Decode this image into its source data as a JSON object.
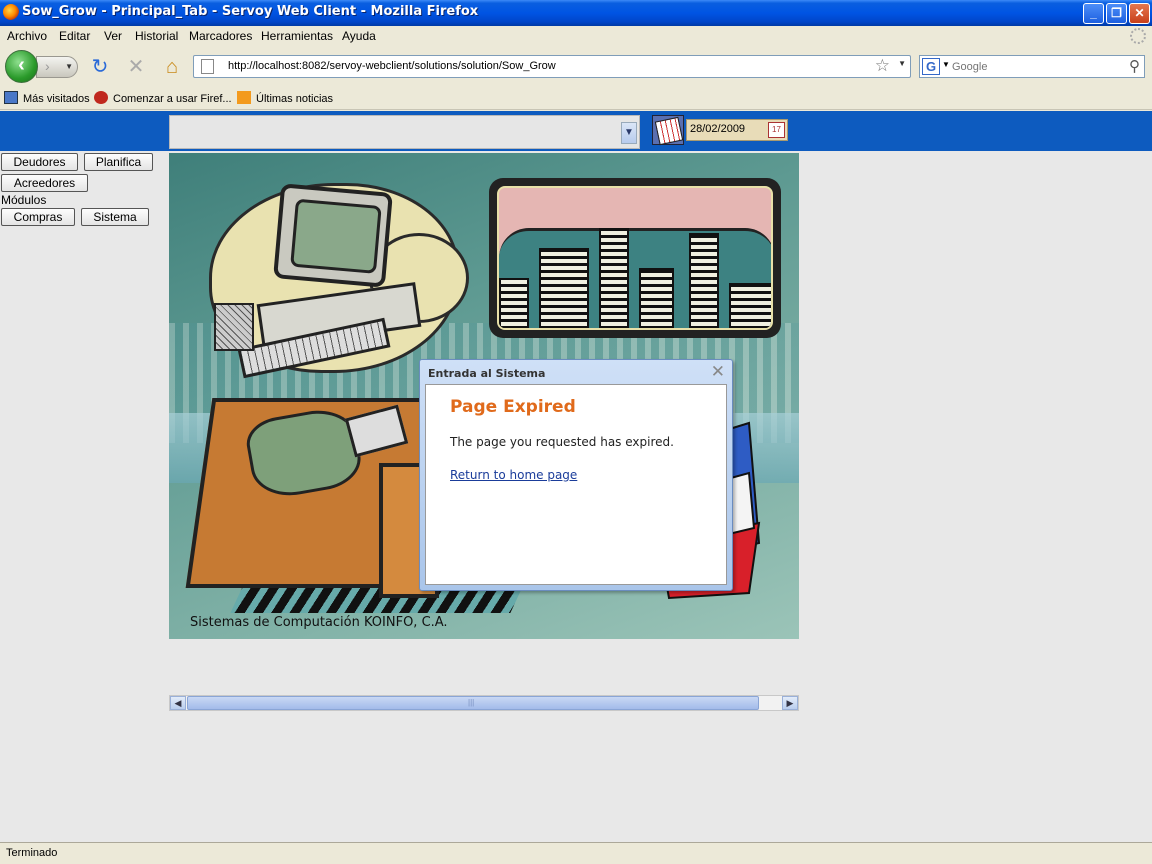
{
  "window": {
    "title": "Sow_Grow - Principal_Tab - Servoy Web Client - Mozilla Firefox"
  },
  "menu": {
    "items": [
      "Archivo",
      "Editar",
      "Ver",
      "Historial",
      "Marcadores",
      "Herramientas",
      "Ayuda"
    ]
  },
  "navbar": {
    "url": "http://localhost:8082/servoy-webclient/solutions/solution/Sow_Grow",
    "search_placeholder": "Google"
  },
  "bookmarks": {
    "items": [
      "Más visitados",
      "Comenzar a usar Firef...",
      "Últimas noticias"
    ]
  },
  "app": {
    "date": "28/02/2009",
    "buttons": {
      "deudores": "Deudores",
      "planifica": "Planifica",
      "acreedores": "Acreedores",
      "compras": "Compras",
      "sistema": "Sistema"
    },
    "modulos_label": "Módulos",
    "caption": "Sistemas de Computación KOINFO, C.A."
  },
  "dialog": {
    "title": "Entrada al Sistema",
    "heading": "Page Expired",
    "message": "The page you requested has expired.",
    "link": "Return to home page"
  },
  "status": {
    "text": "Terminado"
  },
  "colors": {
    "app_header_blue": "#0d5bbf",
    "dialog_heading": "#e06a1b",
    "link": "#1a3c9a"
  }
}
